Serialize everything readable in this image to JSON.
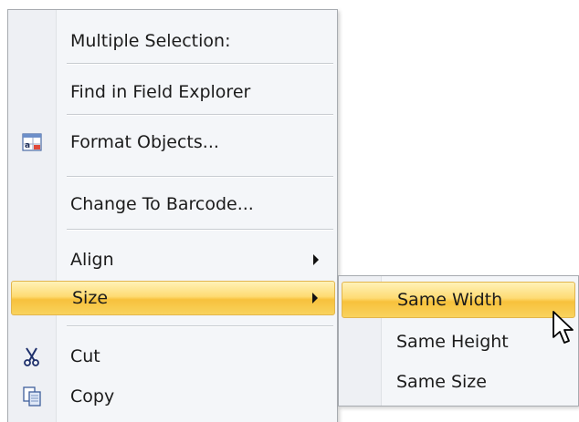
{
  "context_menu": {
    "header": "Multiple Selection:",
    "items": [
      {
        "label": "Find in Field Explorer",
        "icon": ""
      },
      {
        "label": "Format Objects...",
        "icon": "format-objects-icon"
      },
      {
        "label": "Change To Barcode...",
        "icon": ""
      },
      {
        "label": "Align",
        "icon": "",
        "has_submenu": true
      },
      {
        "label": "Size",
        "icon": "",
        "has_submenu": true,
        "highlighted": true
      },
      {
        "label": "Cut",
        "icon": "scissors-icon"
      },
      {
        "label": "Copy",
        "icon": "copy-icon"
      }
    ]
  },
  "size_submenu": {
    "items": [
      {
        "label": "Same Width",
        "highlighted": true
      },
      {
        "label": "Same Height"
      },
      {
        "label": "Same Size"
      }
    ]
  },
  "colors": {
    "highlight_top": "#fff2b8",
    "highlight_mid": "#f7c13c",
    "highlight_border": "#e2b54d",
    "menu_bg": "#f4f6f9"
  }
}
